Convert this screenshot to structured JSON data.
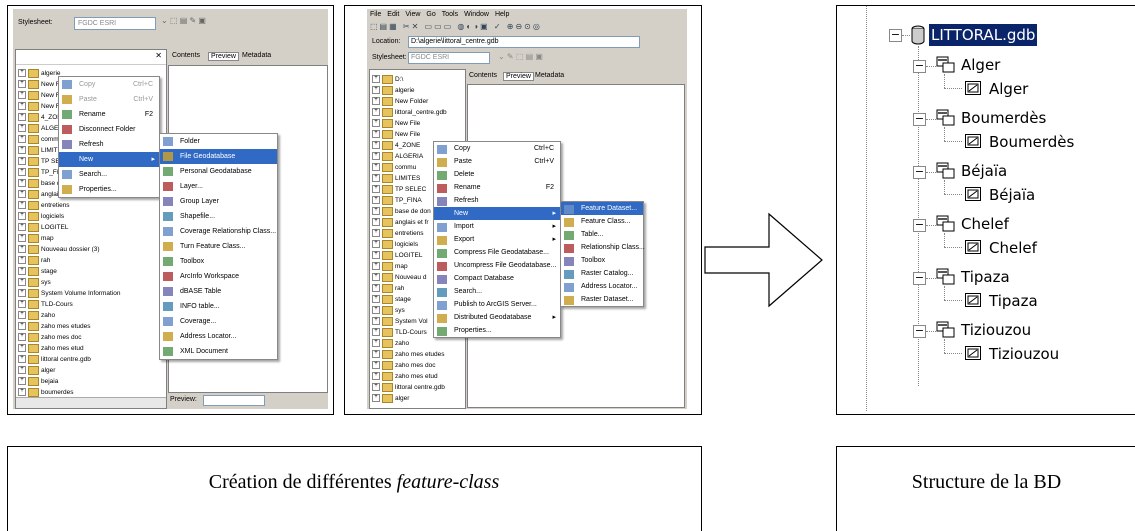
{
  "screen1": {
    "stylesheet_label": "Stylesheet:",
    "stylesheet_value": "FGDC ESRI",
    "tabs": [
      "Contents",
      "Preview",
      "Metadata"
    ],
    "tree": [
      "algerie",
      "New Fold",
      "New File",
      "New File",
      "4_ZONES",
      "ALGERIA",
      "commun",
      "LIMITES_",
      "TP SELEC",
      "TP_FINAL",
      "base de donn",
      "anglais et français",
      "entretiens",
      "logiciels",
      "LOGITEL",
      "map",
      "Nouveau dossier (3)",
      "rah",
      "stage",
      "sys",
      "System Volume Information",
      "TLD-Cours",
      "zaho",
      "zaho  mes etudes",
      "zaho mes doc",
      "zaho mes etud",
      "littoral centre.gdb",
      "alger",
      "bejaia",
      "boumerdes"
    ],
    "context_menu": [
      {
        "label": "Copy",
        "shortcut": "Ctrl+C",
        "disabled": true
      },
      {
        "label": "Paste",
        "shortcut": "Ctrl+V",
        "disabled": true
      },
      {
        "label": "Rename",
        "shortcut": "F2",
        "disabled": false
      },
      {
        "label": "Disconnect Folder",
        "shortcut": "",
        "disabled": false
      },
      {
        "label": "Refresh",
        "shortcut": "",
        "disabled": false
      },
      {
        "label": "New",
        "shortcut": "",
        "disabled": false,
        "highlight": true
      },
      {
        "label": "Search...",
        "shortcut": "",
        "disabled": false
      },
      {
        "label": "Properties...",
        "shortcut": "",
        "disabled": false
      }
    ],
    "new_submenu": [
      "Folder",
      "File Geodatabase",
      "Personal Geodatabase",
      "Layer...",
      "Group Layer",
      "Shapefile...",
      "Coverage Relationship Class...",
      "Turn Feature Class...",
      "Toolbox",
      "ArcInfo Workspace",
      "dBASE Table",
      "INFO table...",
      "Coverage...",
      "Address Locator...",
      "XML Document"
    ],
    "preview_label": "Preview:"
  },
  "screen2": {
    "menubar": [
      "File",
      "Edit",
      "View",
      "Go",
      "Tools",
      "Window",
      "Help"
    ],
    "location_label": "Location:",
    "location_value": "D:\\algerie\\littoral_centre.gdb",
    "stylesheet_label": "Stylesheet:",
    "stylesheet_value": "FGDC ESRI",
    "tabs": [
      "Contents",
      "Preview",
      "Metadata"
    ],
    "tree": [
      "D:\\",
      "algerie",
      "New Folder",
      "littoral_centre.gdb",
      "New File",
      "New File",
      "4_ZONE",
      "ALGERIA",
      "commu",
      "LIMITES",
      "TP SELEC",
      "TP_FINA",
      "base de don",
      "anglais et fr",
      "entretiens",
      "logiciels",
      "LOGITEL",
      "map",
      "Nouveau d",
      "rah",
      "stage",
      "sys",
      "System Vol",
      "TLD-Cours",
      "zaho",
      "zaho  mes etudes",
      "zaho mes doc",
      "zaho mes etud",
      "littoral centre.gdb",
      "alger"
    ],
    "context_menu": [
      {
        "label": "Copy",
        "shortcut": "Ctrl+C"
      },
      {
        "label": "Paste",
        "shortcut": "Ctrl+V"
      },
      {
        "label": "Delete",
        "shortcut": ""
      },
      {
        "label": "Rename",
        "shortcut": "F2"
      },
      {
        "label": "Refresh",
        "shortcut": ""
      },
      {
        "label": "New",
        "shortcut": "",
        "highlight": true
      },
      {
        "label": "Import",
        "shortcut": ""
      },
      {
        "label": "Export",
        "shortcut": ""
      },
      {
        "label": "Compress File Geodatabase...",
        "shortcut": ""
      },
      {
        "label": "Uncompress File Geodatabase...",
        "shortcut": ""
      },
      {
        "label": "Compact Database",
        "shortcut": ""
      },
      {
        "label": "Search...",
        "shortcut": ""
      },
      {
        "label": "Publish to ArcGIS Server...",
        "shortcut": ""
      },
      {
        "label": "Distributed Geodatabase",
        "shortcut": ""
      },
      {
        "label": "Properties...",
        "shortcut": ""
      }
    ],
    "new_submenu": [
      "Feature Dataset...",
      "Feature Class...",
      "Table...",
      "Relationship Class...",
      "Toolbox",
      "Raster Catalog...",
      "Address Locator...",
      "Raster Dataset..."
    ]
  },
  "db_tree": {
    "root": "LITTORAL.gdb",
    "datasets": [
      {
        "name": "Alger",
        "feature_class": "Alger"
      },
      {
        "name": "Boumerdès",
        "feature_class": "Boumerdès"
      },
      {
        "name": "Béjaïa",
        "feature_class": "Béjaïa"
      },
      {
        "name": "Chelef",
        "feature_class": "Chelef"
      },
      {
        "name": "Tipaza",
        "feature_class": "Tipaza"
      },
      {
        "name": "Tiziouzou",
        "feature_class": "Tiziouzou"
      }
    ]
  },
  "captions": {
    "left_plain": "Création de différentes ",
    "left_italic": "feature-class",
    "right": "Structure de la BD"
  },
  "colors": {
    "highlight": "#316ac5",
    "root_highlight": "#0a246a",
    "window_gray": "#d4d0c8"
  }
}
